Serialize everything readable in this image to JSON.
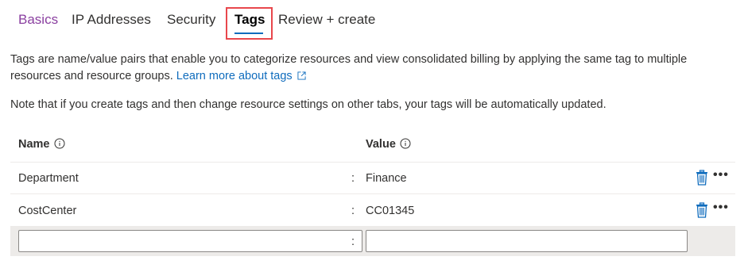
{
  "tabs": [
    {
      "label": "Basics",
      "state": "visited"
    },
    {
      "label": "IP Addresses",
      "state": "default"
    },
    {
      "label": "Security",
      "state": "default"
    },
    {
      "label": "Tags",
      "state": "active"
    },
    {
      "label": "Review + create",
      "state": "default"
    }
  ],
  "description": {
    "text": "Tags are name/value pairs that enable you to categorize resources and view consolidated billing by applying the same tag to multiple resources and resource groups.",
    "link_label": "Learn more about tags"
  },
  "note": "Note that if you create tags and then change resource settings on other tabs, your tags will be automatically updated.",
  "table": {
    "headers": {
      "name": "Name",
      "value": "Value"
    },
    "separator": ":",
    "rows": [
      {
        "name": "Department",
        "value": "Finance"
      },
      {
        "name": "CostCenter",
        "value": "CC01345"
      }
    ],
    "new_row": {
      "name_value": "",
      "value_value": ""
    }
  },
  "colors": {
    "accent": "#0f6cbd",
    "visited_tab": "#8a3fa0",
    "highlight": "#e8474c"
  },
  "icons": [
    "info-icon",
    "external-link-icon",
    "trash-icon",
    "more-icon"
  ]
}
